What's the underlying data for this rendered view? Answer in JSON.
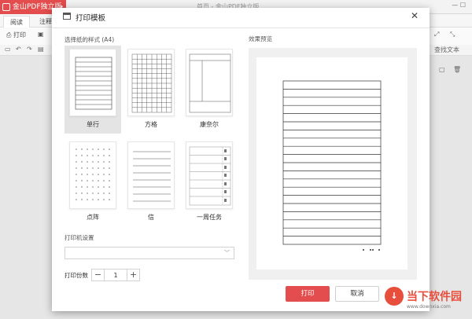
{
  "app": {
    "brand": "金山PDF独立版",
    "doc_title": "首页 - 金山PDF独立版",
    "tabs": [
      "阅读",
      "注释"
    ],
    "ribbon": [
      "打印"
    ],
    "right_tools": [
      "查找文本"
    ]
  },
  "dialog": {
    "title": "打印模板",
    "template_section_label": "选择纸的样式 (A4)",
    "templates": [
      {
        "label": "单行",
        "style": "single-line",
        "selected": true
      },
      {
        "label": "方格",
        "style": "grid",
        "selected": false
      },
      {
        "label": "康奈尔",
        "style": "cornell",
        "selected": false
      },
      {
        "label": "点阵",
        "style": "dots",
        "selected": false
      },
      {
        "label": "信",
        "style": "letter",
        "selected": false
      },
      {
        "label": "一周任务",
        "style": "weekly",
        "selected": false
      }
    ],
    "printer_settings_label": "打印机设置",
    "printer_select_value": "",
    "copies_label": "打印份数",
    "copies_value": "1",
    "preview_label": "效果预览",
    "print_button": "打印",
    "cancel_button": "取消"
  },
  "watermark": {
    "text": "当下软件园",
    "sub": "www.downxia.com"
  },
  "colors": {
    "accent": "#e34d4d",
    "selected_bg": "#e4e4e4",
    "preview_bg": "#f0f0f0"
  }
}
